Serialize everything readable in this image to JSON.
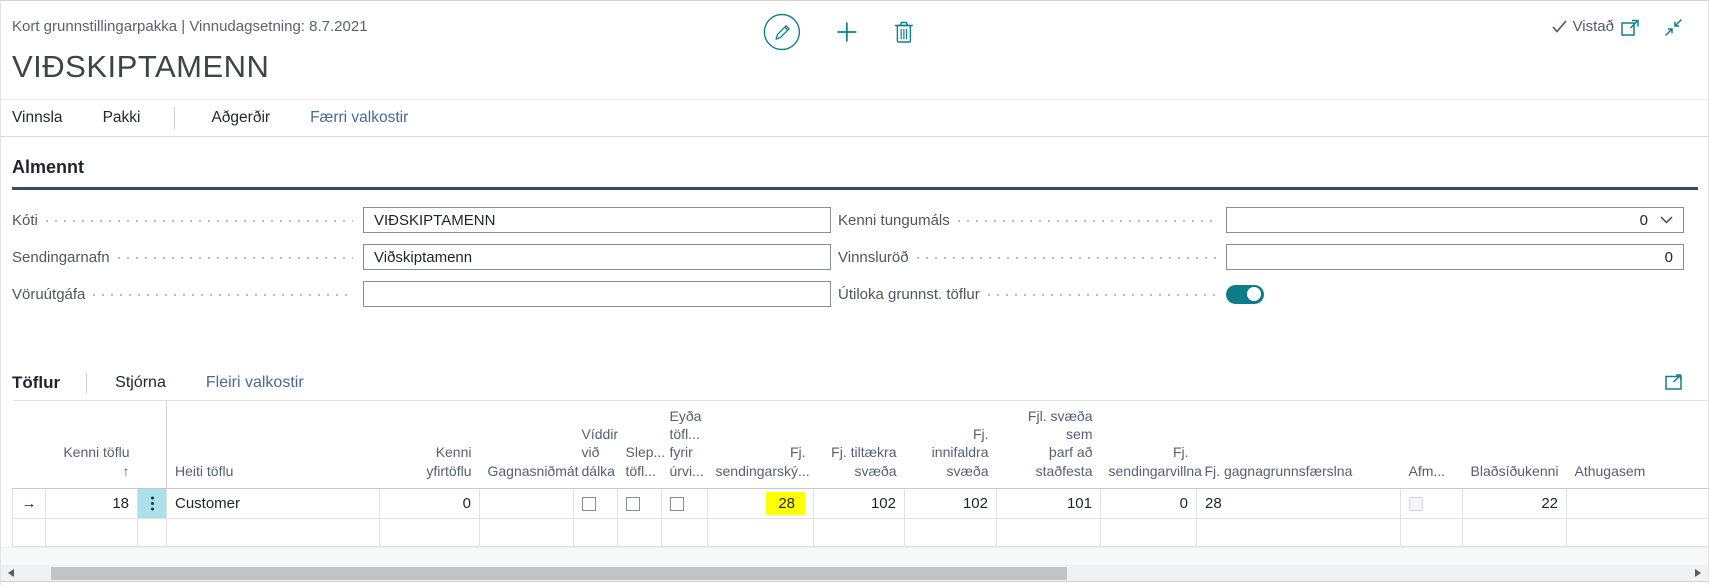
{
  "header": {
    "breadcrumb": "Kort grunnstillingarpakka | Vinnudagsetning: 8.7.2021",
    "title": "VIÐSKIPTAMENN",
    "saved_label": "Vistað"
  },
  "action_bar": {
    "vinnsla": "Vinnsla",
    "pakki": "Pakki",
    "adgerdir": "Aðgerðir",
    "faerri_valkostir": "Færri valkostir"
  },
  "general": {
    "heading": "Almennt",
    "koti_label": "Kóti",
    "koti_value": "VIÐSKIPTAMENN",
    "sendingarnafn_label": "Sendingarnafn",
    "sendingarnafn_value": "Viðskiptamenn",
    "voruutgafa_label": "Vöruútgáfa",
    "voruutgafa_value": "",
    "kenni_tungumals_label": "Kenni tungumáls",
    "kenni_tungumals_value": "0",
    "vinnslurod_label": "Vinnsluröð",
    "vinnslurod_value": "0",
    "utiloka_label": "Útiloka grunnst. töflur",
    "utiloka_enabled": true
  },
  "toflur": {
    "heading": "Töflur",
    "stjorna": "Stjórna",
    "fleiri_valkostir": "Fleiri valkostir",
    "headers": {
      "kenni_toflu": "Kenni töflu ↑",
      "heiti_toflu": "Heiti töflu",
      "kenni_yfirtoflu": "Kenni yfirtöflu",
      "gagnasnidmat": "Gagnasniðmát",
      "viddir_vid_dalka": "Víddir\nvið\ndálka",
      "sleppa_toflu": "Slep...\ntöfl...",
      "eyda_toflu": "Eyða\ntöfl...\nfyrir\núrvi...",
      "fj_sendingarsky": "Fj.\nsendingarský...",
      "fj_tiltaekra_svaeda": "Fj. tiltækra\nsvæða",
      "fj_innifaldra_svaeda": "Fj. innifaldra\nsvæða",
      "fjl_svaeda_stadfesta": "Fjl. svæða sem\nþarf að\nstaðfesta",
      "fj_sendingarvillna": "Fj.\nsendingarvillna",
      "fj_gagnagrunnsfaerslna": "Fj. gagnagrunnsfærslna",
      "afm": "Afm...",
      "bladsidukenni": "Blaðsíðukenni",
      "athugasem": "Athugasem"
    },
    "row": {
      "indicator": "→",
      "kenni_toflu": "18",
      "heiti_toflu": "Customer",
      "kenni_yfirtoflu": "0",
      "gagnasnidmat": "",
      "viddir_vid_dalka_checked": false,
      "sleppa_toflu_checked": false,
      "eyda_toflu_checked": false,
      "fj_sendingarsky": "28",
      "fj_tiltaekra_svaeda": "102",
      "fj_innifaldra_svaeda": "102",
      "fjl_svaeda_stadfesta": "101",
      "fj_sendingarvillna": "0",
      "fj_gagnagrunnsfaerslna": "28",
      "afm_checked": false,
      "bladsidukenni": "22",
      "athugasem": ""
    }
  },
  "colors": {
    "accent_teal": "#12808c",
    "flowfield_link": "#1b7e99",
    "highlight_yellow": "#ffff00"
  }
}
